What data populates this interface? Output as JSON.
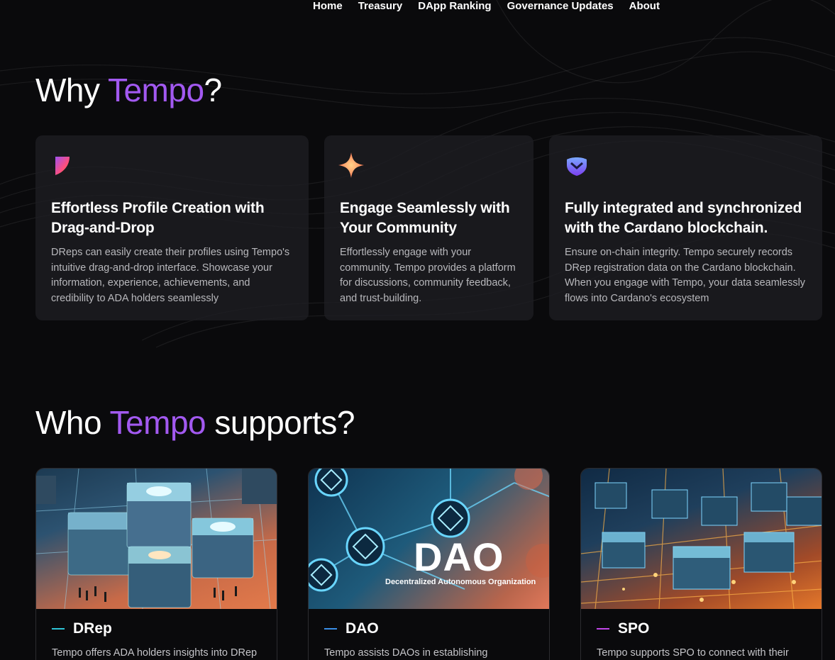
{
  "nav": {
    "items": [
      {
        "label": "Home"
      },
      {
        "label": "Treasury"
      },
      {
        "label": "DApp Ranking"
      },
      {
        "label": "Governance Updates"
      },
      {
        "label": "About"
      }
    ]
  },
  "why": {
    "title_prefix": "Why ",
    "title_accent": "Tempo",
    "title_suffix": "?",
    "cards": [
      {
        "icon": "profile-gradient-icon",
        "heading": "Effortless Profile Creation with Drag-and-Drop",
        "text": "DReps can easily create their profiles using Tempo's intuitive drag-and-drop interface. Showcase your information, experience, achievements, and credibility to ADA holders seamlessly"
      },
      {
        "icon": "sparkle-star-icon",
        "heading": "Engage Seamlessly with Your Community",
        "text": "Effortlessly engage with your community. Tempo provides a platform for discussions, community feedback, and trust-building."
      },
      {
        "icon": "shield-chevron-icon",
        "heading": "Fully integrated and synchronized with the Cardano blockchain.",
        "text": "Ensure on-chain integrity. Tempo securely records DRep registration data on the Cardano blockchain. When you engage with Tempo, your data seamlessly flows into Cardano's ecosystem"
      }
    ]
  },
  "who": {
    "title_prefix": "Who ",
    "title_accent": "Tempo",
    "title_suffix": " supports?",
    "cards": [
      {
        "label": "DRep",
        "text": "Tempo offers ADA holders insights into DRep",
        "dash_color": "#2ec4d6"
      },
      {
        "label": "DAO",
        "text": "Tempo assists DAOs in establishing",
        "dash_color": "#3a8ee6",
        "image_title": "DAO",
        "image_subtitle": "Decentralized Autonomous Organization"
      },
      {
        "label": "SPO",
        "text": "Tempo supports SPO to connect with their",
        "dash_color": "#c046e8"
      }
    ]
  },
  "colors": {
    "accent": "#a259f0",
    "background": "#0a0a0c",
    "card": "#1e1e22"
  }
}
